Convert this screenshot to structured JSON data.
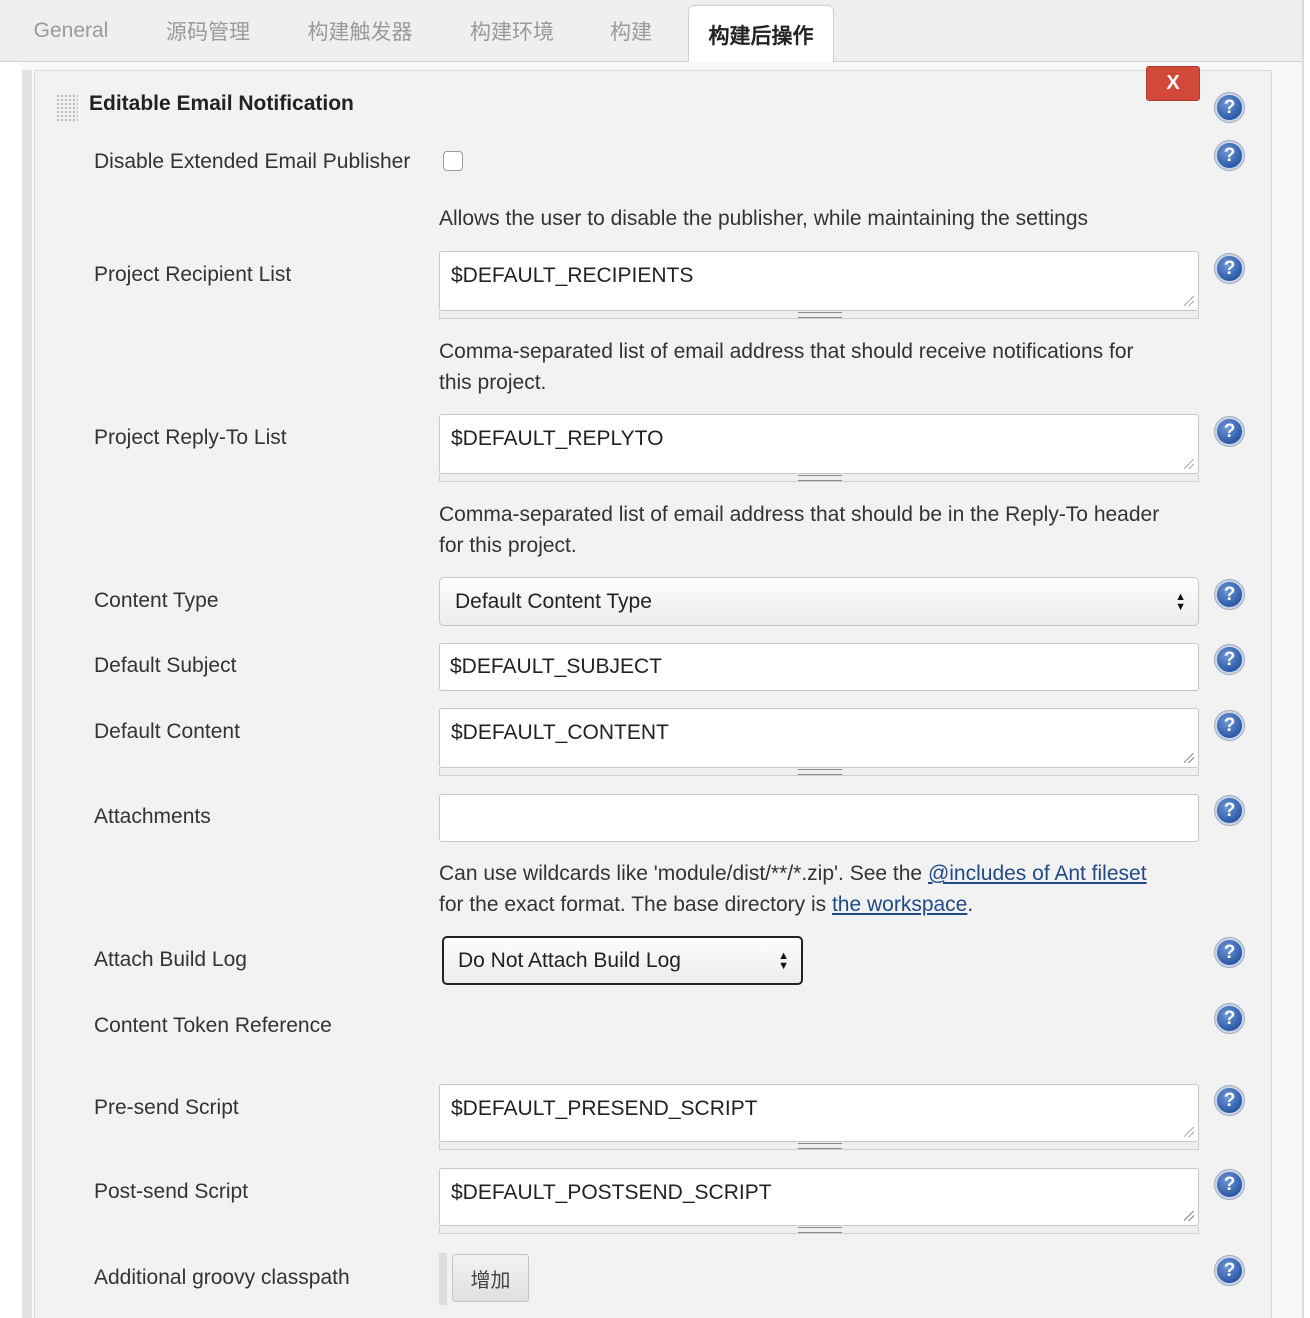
{
  "tabs": [
    {
      "label": "General"
    },
    {
      "label": "源码管理"
    },
    {
      "label": "构建触发器"
    },
    {
      "label": "构建环境"
    },
    {
      "label": "构建"
    },
    {
      "label": "构建后操作"
    }
  ],
  "section": {
    "title": "Editable Email Notification",
    "delete_label": "X",
    "help_glyph": "?"
  },
  "fields": {
    "disable_publisher": {
      "label": "Disable Extended Email Publisher",
      "checked": false,
      "help": "Allows the user to disable the publisher, while maintaining the settings"
    },
    "recipient_list": {
      "label": "Project Recipient List",
      "value": "$DEFAULT_RECIPIENTS",
      "help_line1": "Comma-separated list of email address that should receive notifications for",
      "help_line2": "this project."
    },
    "reply_to_list": {
      "label": "Project Reply-To List",
      "value": "$DEFAULT_REPLYTO",
      "help_line1": "Comma-separated list of email address that should be in the Reply-To header",
      "help_line2": "for this project."
    },
    "content_type": {
      "label": "Content Type",
      "selected": "Default Content Type"
    },
    "default_subject": {
      "label": "Default Subject",
      "value": "$DEFAULT_SUBJECT"
    },
    "default_content": {
      "label": "Default Content",
      "value": "$DEFAULT_CONTENT"
    },
    "attachments": {
      "label": "Attachments",
      "value": "",
      "help_prefix": "Can use wildcards like 'module/dist/**/*.zip'. See the ",
      "help_link1": "@includes of Ant fileset",
      "help_middle": "for the exact format. The base directory is ",
      "help_link2": "the workspace",
      "help_suffix": "."
    },
    "attach_build_log": {
      "label": "Attach Build Log",
      "selected": "Do Not Attach Build Log"
    },
    "content_token_reference": {
      "label": "Content Token Reference"
    },
    "presend_script": {
      "label": "Pre-send Script",
      "value": "$DEFAULT_PRESEND_SCRIPT"
    },
    "postsend_script": {
      "label": "Post-send Script",
      "value": "$DEFAULT_POSTSEND_SCRIPT"
    },
    "groovy_classpath": {
      "label": "Additional groovy classpath",
      "add_label": "增加"
    }
  },
  "icons": {
    "help": "help-icon",
    "drag": "drag-handle-icon",
    "select_arrows": "updown-arrows-icon"
  },
  "colors": {
    "delete_button": "#d24939",
    "help_icon": "#2c5aa8",
    "link": "#204a87"
  }
}
